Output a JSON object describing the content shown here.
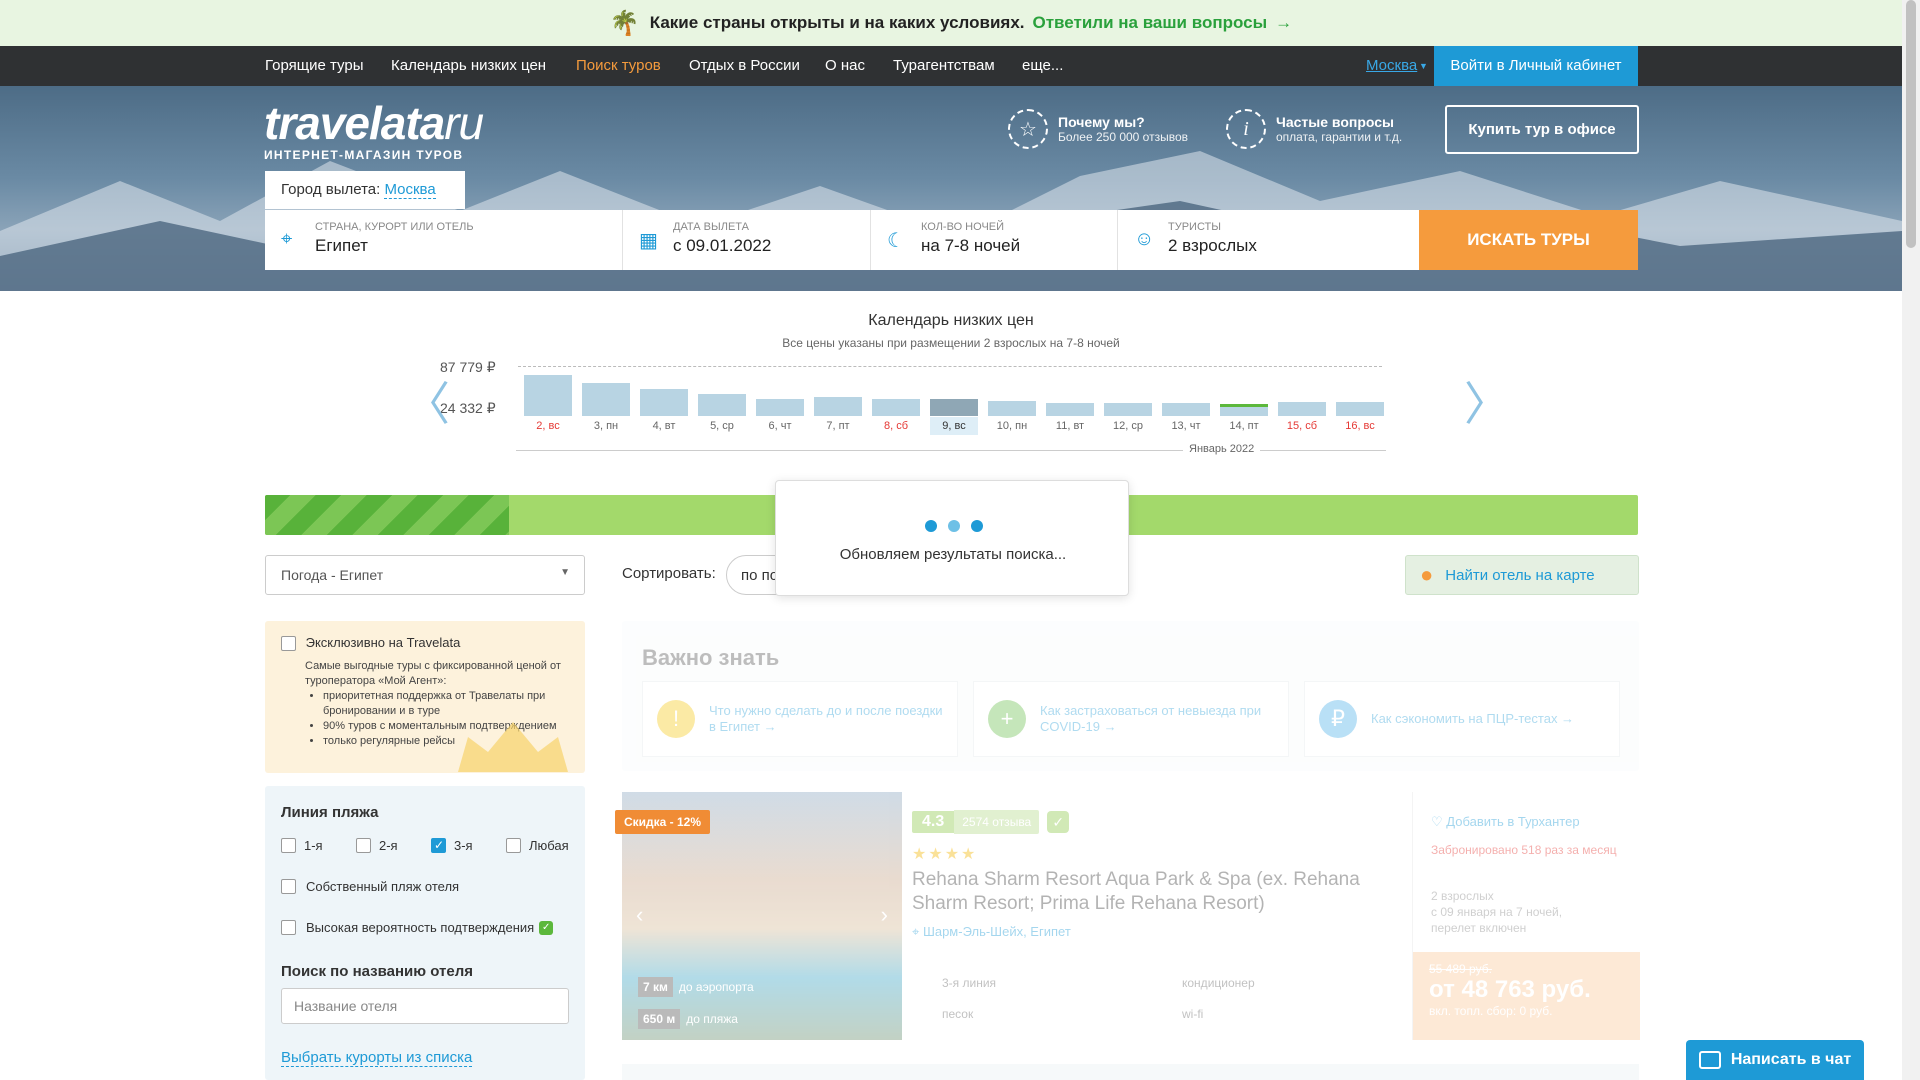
{
  "promo": {
    "icon": "palm-tree-icon",
    "text": "Какие страны открыты и на каких условиях.",
    "link": "Ответили на ваши вопросы"
  },
  "nav": {
    "items": [
      "Горящие туры",
      "Календарь низких цен",
      "Поиск туров",
      "Отдых в России",
      "О нас",
      "Турагентствам",
      "еще..."
    ],
    "active_index": 2,
    "city": "Москва",
    "login": "Войти в Личный кабинет"
  },
  "header": {
    "logo_main": "travelata",
    "logo_suffix": "ru",
    "logo_sub": "ИНТЕРНЕТ-МАГАЗИН ТУРОВ",
    "why_title": "Почему мы?",
    "why_sub": "Более 250 000 отзывов",
    "faq_title": "Частые вопросы",
    "faq_sub": "оплата, гарантии и т.д.",
    "office_btn": "Купить тур в офисе"
  },
  "search": {
    "depart_label": "Город вылета:",
    "depart_city": "Москва",
    "country_label": "СТРАНА, КУРОРТ ИЛИ ОТЕЛЬ",
    "country_value": "Египет",
    "date_label": "ДАТА ВЫЛЕТА",
    "date_value": "с 09.01.2022",
    "nights_label": "КОЛ-ВО НОЧЕЙ",
    "nights_value": "на 7-8 ночей",
    "tourists_label": "ТУРИСТЫ",
    "tourists_value": "2 взрослых",
    "button": "ИСКАТЬ ТУРЫ"
  },
  "chart_data": {
    "type": "bar",
    "title": "Календарь низких цен",
    "subtitle": "Все цены указаны при размещении 2 взрослых на 7-8 ночей",
    "xlabel": "Январь 2022",
    "ytick_labels": [
      "87 779 ₽",
      "24 332 ₽"
    ],
    "ylim": [
      24332,
      87779
    ],
    "categories": [
      "2, вс",
      "3, пн",
      "4, вт",
      "5, ср",
      "6, чт",
      "7, пт",
      "8, сб",
      "9, вс",
      "10, пн",
      "11, вт",
      "12, ср",
      "13, чт",
      "14, пт",
      "15, сб",
      "16, вс"
    ],
    "values": [
      87779,
      72000,
      60000,
      50000,
      40500,
      44500,
      40500,
      40000,
      36500,
      32500,
      32000,
      32500,
      30500,
      34000,
      34000
    ],
    "weekend_indices": [
      0,
      6,
      13,
      14
    ],
    "selected_index": 7,
    "highlight_index": 12
  },
  "progress": {
    "fraction": 0.178
  },
  "loader": {
    "message": "Обновляем результаты поиска..."
  },
  "toolbar": {
    "weather": "Погода - Египет",
    "sort_label": "Сортировать:",
    "sort_value": "по популярности",
    "map_btn": "Найти отель на карте"
  },
  "exclusive": {
    "title": "Эксклюзивно на Travelata",
    "desc": "Самые выгодные туры с фиксированной ценой от туроператора «Мой Агент»:",
    "bullets": [
      "приоритетная поддержка от Травелаты при бронировании и в туре",
      "90% туров с моментальным подтверждением",
      "только регулярные рейсы"
    ]
  },
  "filters": {
    "beach_title": "Линия пляжа",
    "beach_options": [
      {
        "label": "1-я",
        "checked": false
      },
      {
        "label": "2-я",
        "checked": false
      },
      {
        "label": "3-я",
        "checked": true
      },
      {
        "label": "Любая",
        "checked": false
      }
    ],
    "own_beach": "Собственный пляж отеля",
    "high_confirm": "Высокая вероятность подтверждения",
    "hotel_search_title": "Поиск по названию отеля",
    "hotel_placeholder": "Название отеля",
    "resorts_link": "Выбрать курорты из списка"
  },
  "important": {
    "title": "Важно знать",
    "cards": [
      {
        "icon": "exclamation-icon",
        "text": "Что нужно сделать до и после поездки в Египет →",
        "color": "#f5c400"
      },
      {
        "icon": "plus-icon",
        "text": "Как застраховаться от невыезда при COVID-19 →",
        "color": "#5cb83c"
      },
      {
        "icon": "ruble-icon",
        "text": "Как сэкономить на ПЦР-тестах →",
        "color": "#39a8e6"
      }
    ]
  },
  "hotel": {
    "discount": "Скидка - 12%",
    "rating": "4.3",
    "reviews": "2574 отзыва",
    "stars": "★★★★",
    "name": "Rehana Sharm Resort Aqua Park & Spa (ex. Rehana Sharm Resort; Prima Life Rehana Resort)",
    "location": "Шарм-Эль-Шейх, Египет",
    "airport_dist": "7 км",
    "airport_lbl": "до аэропорта",
    "beach_dist": "650 м",
    "beach_lbl": "до пляжа",
    "line": "3-я линия",
    "sand": "песок",
    "ac": "кондиционер",
    "wifi": "wi-fi",
    "wishlist": "Добавить в Турхантер",
    "booked": "Забронировано 518 раз за месяц",
    "tourists": "2 взрослых",
    "dates": "с 09 января на 7 ночей,",
    "flight": "перелет включен",
    "old_price": "55 489 руб.",
    "price": "от 48 763 руб.",
    "fee": "вкл. топл. сбор: 0 руб."
  },
  "chat": {
    "label": "Написать в чат"
  }
}
